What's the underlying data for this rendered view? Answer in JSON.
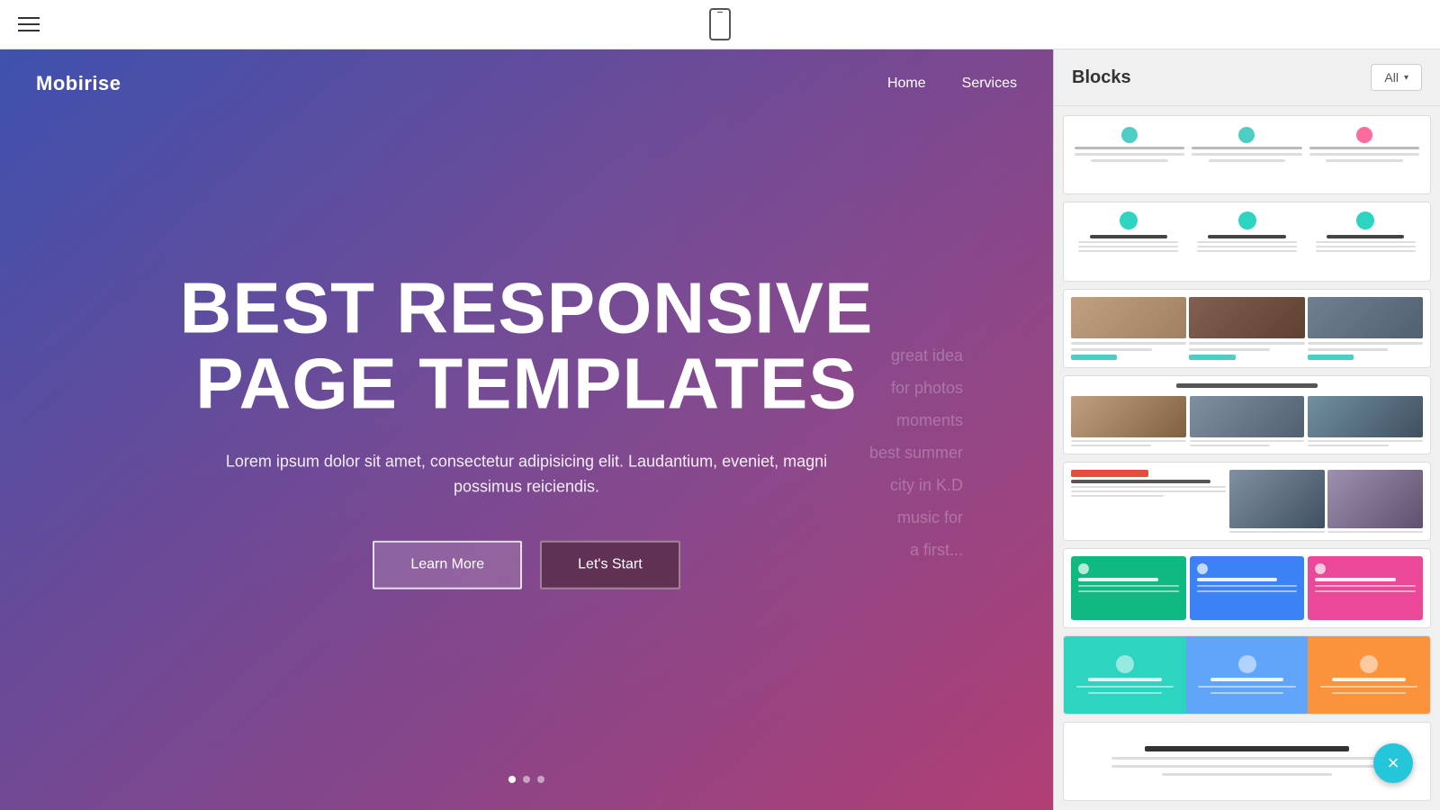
{
  "toolbar": {
    "hamburger_label": "Menu",
    "device_icon": "phone"
  },
  "hero": {
    "brand": "Mobirise",
    "nav": {
      "home": "Home",
      "services": "Services"
    },
    "title_line1": "BEST RESPONSIVE",
    "title_line2": "PAGE TEMPLATES",
    "subtitle": "Lorem ipsum dolor sit amet, consectetur adipisicing elit. Laudantium, eveniet, magni possimus reiciendis.",
    "btn_learn_more": "Learn More",
    "btn_lets_start": "Let's Start",
    "overlay_lines": [
      "great idea",
      "for photos",
      "moments",
      "best summer",
      "city in K.D",
      "music for",
      "a first..."
    ]
  },
  "blocks_panel": {
    "title": "Blocks",
    "filter_btn": "All",
    "filter_arrow": "▾",
    "thumbnails": [
      {
        "id": "block-1",
        "type": "features-icons"
      },
      {
        "id": "block-2",
        "type": "features-teal-dots"
      },
      {
        "id": "block-3",
        "type": "photo-grid"
      },
      {
        "id": "block-4",
        "type": "blog-grid"
      },
      {
        "id": "block-5",
        "type": "news-mixed"
      },
      {
        "id": "block-6",
        "type": "colored-services"
      },
      {
        "id": "block-7",
        "type": "colored-boxes"
      },
      {
        "id": "block-8",
        "type": "promo-text"
      }
    ]
  },
  "close_button": {
    "icon": "×",
    "label": "Close blocks panel"
  }
}
